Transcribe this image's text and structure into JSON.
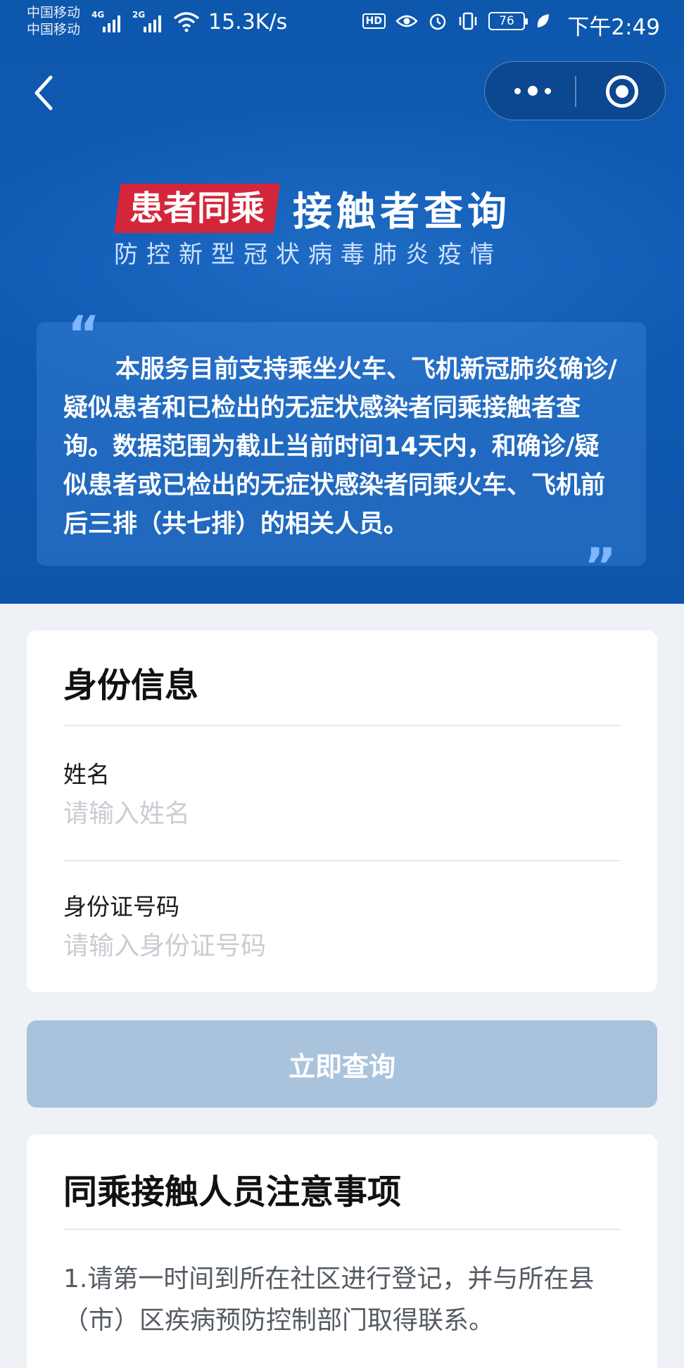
{
  "status_bar": {
    "carrier_1": "中国移动",
    "carrier_2": "中国移动",
    "network_1": "4G",
    "network_2": "2G",
    "speed": "15.3K/s",
    "hd": "HD",
    "battery": "76",
    "time": "下午2:49"
  },
  "header": {
    "badge": "患者同乘",
    "title": "接触者查询",
    "subtitle": "防控新型冠状病毒肺炎疫情",
    "description": "本服务目前支持乘坐火车、飞机新冠肺炎确诊/疑似患者和已检出的无症状感染者同乘接触者查询。数据范围为截止当前时间14天内，和确诊/疑似患者或已检出的无症状感染者同乘火车、飞机前后三排（共七排）的相关人员。",
    "quote_open": "“",
    "quote_close": "”"
  },
  "form": {
    "title": "身份信息",
    "name_label": "姓名",
    "name_placeholder": "请输入姓名",
    "id_label": "身份证号码",
    "id_placeholder": "请输入身份证号码",
    "submit_label": "立即查询"
  },
  "notes": {
    "title": "同乘接触人员注意事项",
    "item_1": "1.请第一时间到所在社区进行登记，并与所在县（市）区疾病预防控制部门取得联系。"
  },
  "colors": {
    "header_blue": "#0f5ab3",
    "badge_red": "#d4263a",
    "button_disabled": "#aac3dd"
  }
}
